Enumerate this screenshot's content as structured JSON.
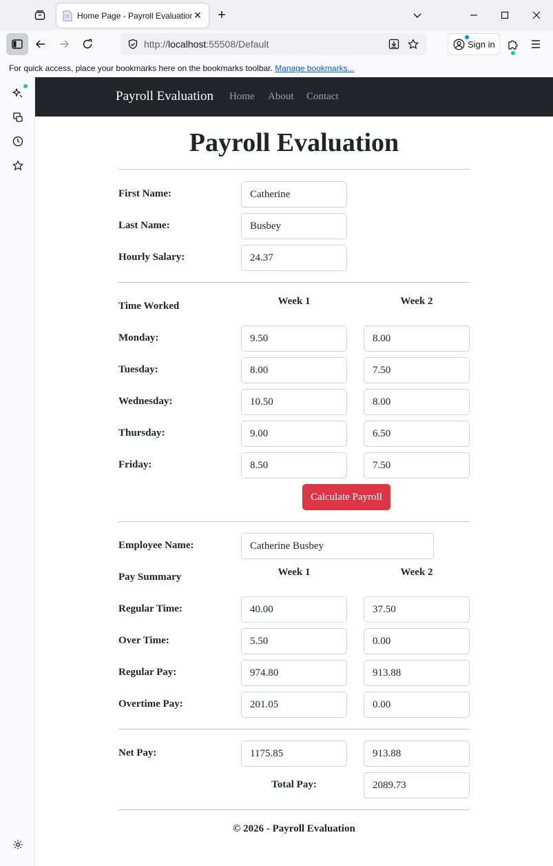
{
  "browser": {
    "tab_title": "Home Page - Payroll Evaluation",
    "url_scheme": "http://",
    "url_host": "localhost",
    "url_rest": ":55508/Default",
    "sign_in_label": "Sign in",
    "bookmarks_text": "For quick access, place your bookmarks here on the bookmarks toolbar.",
    "bookmarks_link": "Manage bookmarks..."
  },
  "site_nav": {
    "brand": "Payroll Evaluation",
    "links": [
      "Home",
      "About",
      "Contact"
    ]
  },
  "page": {
    "title": "Payroll Evaluation",
    "employee": {
      "first_name_label": "First Name:",
      "first_name": "Catherine",
      "last_name_label": "Last Name:",
      "last_name": "Busbey",
      "hourly_salary_label": "Hourly Salary:",
      "hourly_salary": "24.37"
    },
    "time_worked": {
      "section_label": "Time Worked",
      "week1_label": "Week 1",
      "week2_label": "Week 2",
      "days": [
        {
          "label": "Monday:",
          "week1": "9.50",
          "week2": "8.00"
        },
        {
          "label": "Tuesday:",
          "week1": "8.00",
          "week2": "7.50"
        },
        {
          "label": "Wednesday:",
          "week1": "10.50",
          "week2": "8.00"
        },
        {
          "label": "Thursday:",
          "week1": "9.00",
          "week2": "6.50"
        },
        {
          "label": "Friday:",
          "week1": "8.50",
          "week2": "7.50"
        }
      ]
    },
    "calculate_button": "Calculate Payroll",
    "summary": {
      "employee_name_label": "Employee Name:",
      "employee_name": "Catherine Busbey",
      "section_label": "Pay Summary",
      "week1_label": "Week 1",
      "week2_label": "Week 2",
      "rows": [
        {
          "label": "Regular Time:",
          "week1": "40.00",
          "week2": "37.50"
        },
        {
          "label": "Over Time:",
          "week1": "5.50",
          "week2": "0.00"
        },
        {
          "label": "Regular Pay:",
          "week1": "974.80",
          "week2": "913.88"
        },
        {
          "label": "Overtime Pay:",
          "week1": "201.05",
          "week2": "0.00"
        }
      ]
    },
    "totals": {
      "net_pay_label": "Net Pay:",
      "net_pay_week1": "1175.85",
      "net_pay_week2": "913.88",
      "total_pay_label": "Total Pay:",
      "total_pay": "2089.73"
    },
    "footer": "© 2026 - Payroll Evaluation"
  },
  "colors": {
    "navbar_bg": "#212529",
    "button_danger": "#dc3545",
    "link_blue": "#0060df"
  },
  "icons": {
    "tab_manager": "tab-manager-icon",
    "sidebar_toggle": "sidebar-toggle-icon",
    "back": "arrow-left-icon",
    "forward": "arrow-right-icon",
    "reload": "reload-icon",
    "shield": "shield-icon",
    "save_page": "download-icon",
    "bookmark": "star-icon",
    "account": "account-icon",
    "extensions": "puzzle-icon",
    "menu": "hamburger-menu-icon"
  }
}
